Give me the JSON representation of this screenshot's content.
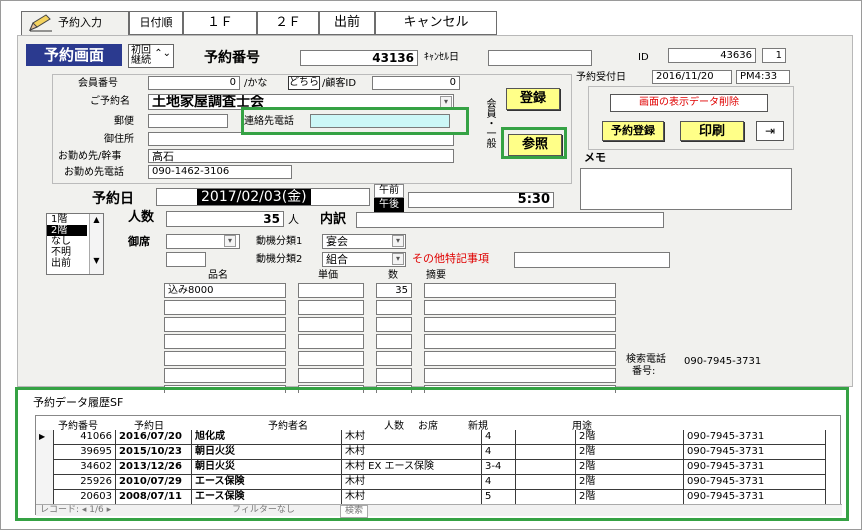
{
  "tabs": [
    {
      "label": "予約入力"
    },
    {
      "label": "日付順"
    },
    {
      "label": "１Ｆ"
    },
    {
      "label": "２Ｆ"
    },
    {
      "label": "出前"
    },
    {
      "label": "キャンセル"
    }
  ],
  "header": {
    "screen_title": "予約画面",
    "mode_label1": "初回",
    "mode_label2": "継続",
    "reservation_no_label": "予約番号",
    "reservation_no": "43136",
    "cancel_date_label": "ｷｬﾝｾﾙ日",
    "cancel_date": "",
    "id_label": "ID",
    "id_value": "43636",
    "id_seq": "1",
    "received_date_label": "予約受付日",
    "received_date": "2016/11/20",
    "received_time": "PM4:33"
  },
  "member": {
    "member_no_label": "会員番号",
    "member_no": "0",
    "kana_label": "/かな",
    "toggle_label": "どちら",
    "customer_id_label": "/顧客ID",
    "customer_id": "0",
    "name_label": "ご予約名",
    "name": "土地家屋調査士会",
    "postal_label": "郵便",
    "postal": "",
    "contact_phone_label": "連絡先電話",
    "contact_phone": "",
    "address_label": "御住所",
    "address": "",
    "workplace_label": "お勤め先/幹事",
    "workplace": "高石",
    "workplace_phone_label": "お勤め先電話",
    "workplace_phone": "090-1462-3106",
    "member_type_label": "会員・一般"
  },
  "buttons": {
    "register": "登録",
    "reference": "参照",
    "delete_display": "画面の表示データ削除",
    "reserve_register": "予約登録",
    "print": "印刷"
  },
  "memo_label": "メモ",
  "reservation": {
    "date_label": "予約日",
    "date": "2017/02/03(金)",
    "am_label": "午前",
    "pm_label": "午後",
    "time": "5:30",
    "floor_options": [
      "1階",
      "2階",
      "なし",
      "不明",
      "出前"
    ],
    "floor_selected": "2階",
    "people_label": "人数",
    "people": "35",
    "people_unit": "人",
    "breakdown_label": "内訳",
    "seat_label": "御席",
    "motive1_label": "動機分類1",
    "motive1": "宴会",
    "motive2_label": "動機分類2",
    "motive2": "組合",
    "other_notes_label": "その他特記事項"
  },
  "items": {
    "headers": [
      "品名",
      "単価",
      "数",
      "摘要"
    ],
    "rows": [
      [
        "込み8000",
        "",
        "35",
        ""
      ],
      [
        "",
        "",
        "",
        ""
      ],
      [
        "",
        "",
        "",
        ""
      ],
      [
        "",
        "",
        "",
        ""
      ],
      [
        "",
        "",
        "",
        ""
      ],
      [
        "",
        "",
        "",
        ""
      ],
      [
        "",
        "",
        "",
        ""
      ]
    ]
  },
  "search_phone": {
    "label1": "検索電話",
    "label2": "番号:",
    "value": "090-7945-3731"
  },
  "history": {
    "title": "予約データ履歴SF",
    "headers": [
      "予約番号",
      "予約日",
      "予約者名",
      "人数",
      "お席",
      "新規",
      "用途"
    ],
    "rows": [
      [
        "41066",
        "2016/07/20",
        "旭化成",
        "木村",
        "",
        "4",
        "2階",
        "090-7945-3731"
      ],
      [
        "39695",
        "2015/10/23",
        "朝日火災",
        "木村",
        "",
        "4",
        "2階",
        "090-7945-3731"
      ],
      [
        "34602",
        "2013/12/26",
        "朝日火災",
        "木村 EX エース保険",
        "",
        "3-4",
        "2階",
        "090-7945-3731"
      ],
      [
        "25926",
        "2010/07/29",
        "エース保険",
        "木村",
        "",
        "4",
        "2階",
        "090-7945-3731"
      ],
      [
        "20603",
        "2008/07/11",
        "エース保険",
        "木村",
        "",
        "5",
        "2階",
        "090-7945-3731"
      ]
    ],
    "nav_text": "レコード: ◂ 1/6 ▸",
    "filter_text": "フィルターなし",
    "search_text": "検索"
  },
  "colors": {
    "highlight_green": "#35a244",
    "button_yellow": "#ffff88",
    "danger_red": "#e00000",
    "title_blue": "#2b3a8f"
  }
}
